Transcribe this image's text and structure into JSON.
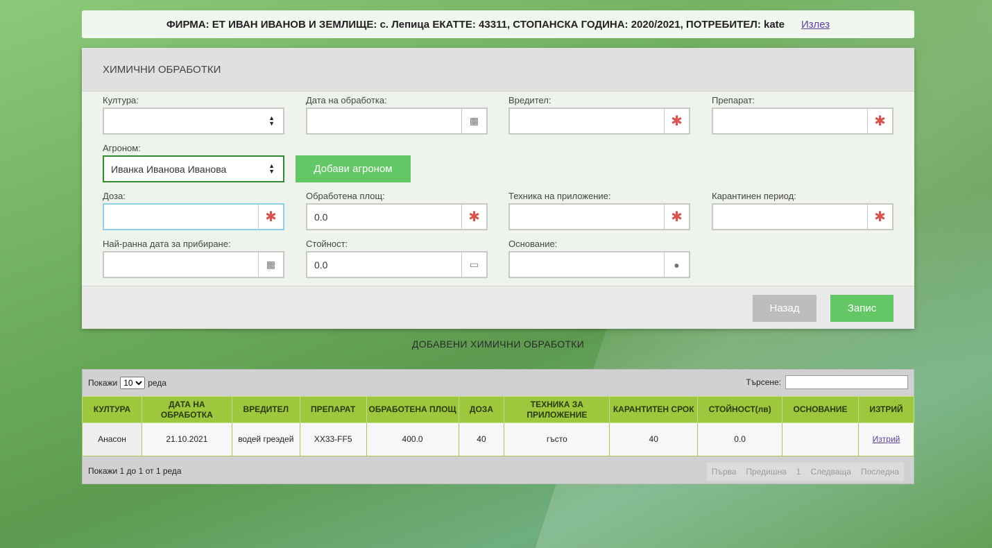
{
  "header": {
    "text": "ФИРМА: ЕТ ИВАН ИВАНОВ И ЗЕМЛИЩЕ: с. Лепица ЕКАТТЕ: 43311, СТОПАНСКА ГОДИНА: 2020/2021, ПОТРЕБИТЕЛ: kate",
    "logout": "Излез"
  },
  "form": {
    "title": "ХИМИЧНИ ОБРАБОТКИ",
    "culture_label": "Култура:",
    "culture_value": "",
    "date_label": "Дата на обработка:",
    "date_value": "",
    "pest_label": "Вредител:",
    "pest_value": "",
    "product_label": "Препарат:",
    "product_value": "",
    "agronomist_label": "Агроном:",
    "agronomist_value": "Иванка Иванова Иванова",
    "add_agronomist": "Добави агроном",
    "dose_label": "Доза:",
    "dose_value": "",
    "area_label": "Обработена площ:",
    "area_value": "0.0",
    "technique_label": "Техника на приложение:",
    "technique_value": "",
    "quarantine_label": "Карантинен период:",
    "quarantine_value": "",
    "harvest_label": "Най-ранна дата за прибиране:",
    "harvest_value": "",
    "cost_label": "Стойност:",
    "cost_value": "0.0",
    "basis_label": "Основание:",
    "basis_value": "",
    "back_button": "Назад",
    "save_button": "Запис"
  },
  "list": {
    "title": "ДОБАВЕНИ ХИМИЧНИ ОБРАБОТКИ",
    "show_label": "Покажи",
    "rows_label": "реда",
    "page_size": "10",
    "search_label": "Търсене:",
    "search_value": "",
    "columns": [
      "КУЛТУРА",
      "ДАТА НА ОБРАБОТКА",
      "ВРЕДИТЕЛ",
      "ПРЕПАРАТ",
      "ОБРАБОТЕНА ПЛОЩ",
      "ДОЗА",
      "ТЕХНИКА ЗА ПРИЛОЖЕНИЕ",
      "КАРАНТИТЕН СРОК",
      "СТОЙНОСТ(лв)",
      "ОСНОВАНИЕ",
      "ИЗТРИЙ"
    ],
    "rows": [
      [
        "Анасон",
        "21.10.2021",
        "водей греэдей",
        "XX33-FF5",
        "400.0",
        "40",
        "гъсто",
        "40",
        "0.0",
        "",
        "Изтрий"
      ]
    ],
    "info": "Покажи 1 до 1 от 1 реда",
    "pager": [
      "Първа",
      "Предишна",
      "1",
      "Следваща",
      "Последна"
    ]
  },
  "icons": {
    "calendar": "calendar-icon",
    "required": "asterisk-icon",
    "card": "credit-card-icon",
    "user": "user-icon"
  }
}
